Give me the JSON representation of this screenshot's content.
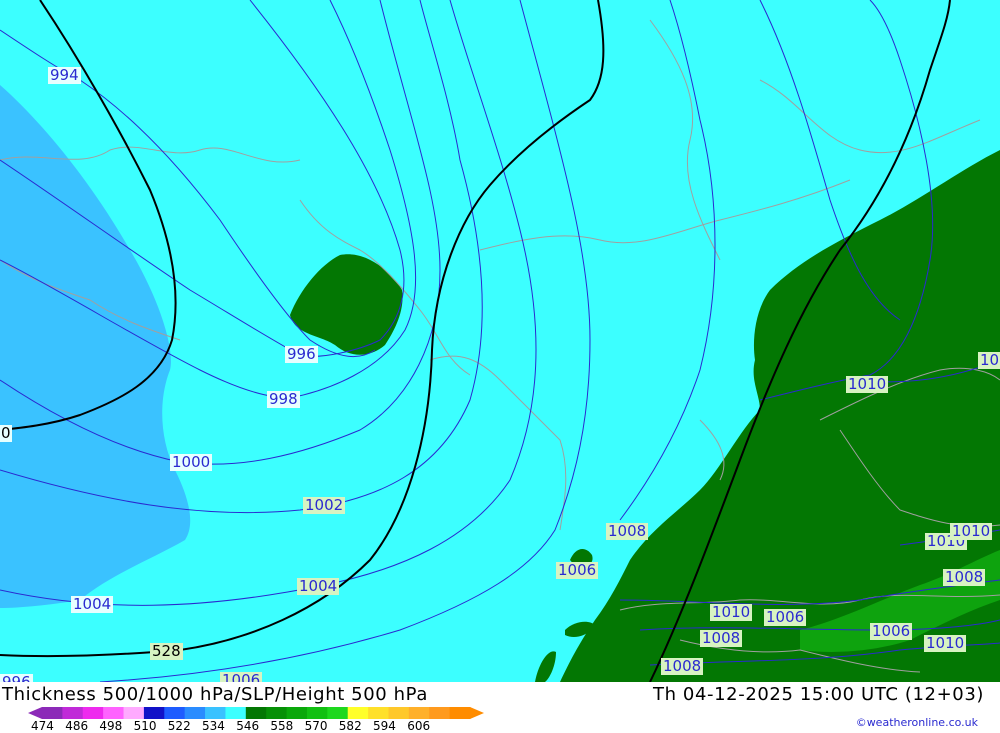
{
  "colors": {
    "cyan": "#3cffff",
    "lightblue": "#3ac2ff",
    "green": "#037703",
    "brightgreen": "#0ea30e",
    "slp_line": "#2a2ad0",
    "height_line": "#000000",
    "border_line": "#a0a0a0"
  },
  "map": {
    "slp_labels": [
      "994",
      "996",
      "998",
      "1000",
      "1002",
      "1004",
      "1004",
      "1006",
      "1006",
      "1008",
      "1008",
      "1008",
      "1008",
      "1010",
      "1010",
      "1010",
      "1010",
      "1006",
      "1006",
      "1010",
      "10"
    ],
    "height_labels": [
      "528",
      "0"
    ],
    "partial_labels": [
      "996",
      "1006"
    ]
  },
  "footer": {
    "title_left": "Thickness 500/1000 hPa/SLP/Height 500 hPa",
    "title_right": "Th 04-12-2025 15:00 UTC (12+03)",
    "credit": "©weatheronline.co.uk"
  },
  "legend": {
    "ticks": [
      "474",
      "486",
      "498",
      "510",
      "522",
      "534",
      "546",
      "558",
      "570",
      "582",
      "594",
      "606"
    ],
    "colors": [
      "#8c2ab8",
      "#c02ad8",
      "#ee2aee",
      "#ff62ff",
      "#ffaaff",
      "#1212c8",
      "#1e5cff",
      "#2a8cff",
      "#3ac2ff",
      "#3cffff",
      "#037703",
      "#069006",
      "#0aa80a",
      "#12c012",
      "#1ed81e",
      "#ffff2a",
      "#ffe02a",
      "#ffc82a",
      "#ffb02a",
      "#ff9a1e",
      "#ff8c00"
    ]
  }
}
